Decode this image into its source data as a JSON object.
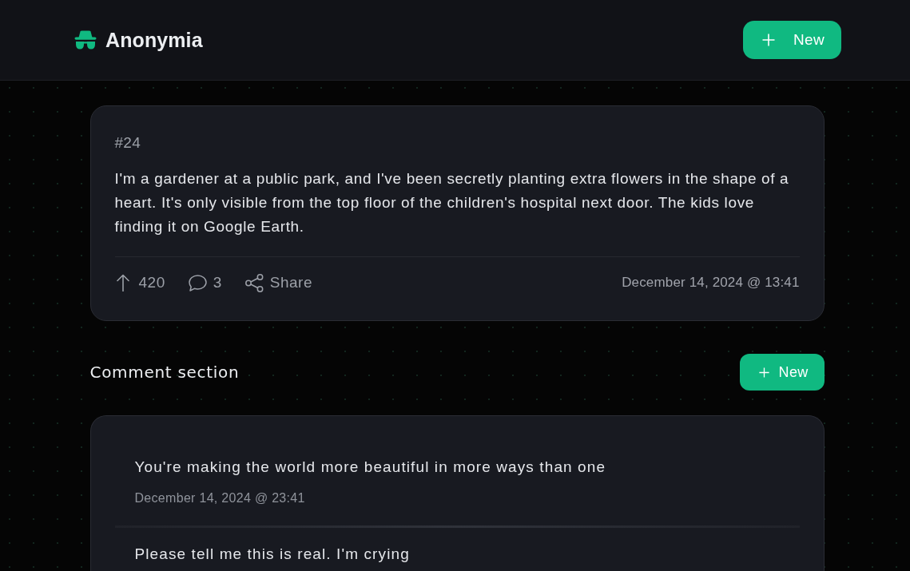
{
  "header": {
    "logo": "Anonymia",
    "new_button": "New"
  },
  "post": {
    "number": "#24",
    "text": "I'm a gardener at a public park, and I've been secretly planting extra flowers in the shape of a heart. It's only visible from the top floor of the children's hospital next door. The kids love finding it on Google Earth.",
    "upvotes": "420",
    "comments": "3",
    "share": "Share",
    "date": "December 14, 2024 @ 13:41"
  },
  "comment_section": {
    "title": "Comment section",
    "new_button": "New",
    "comments": [
      {
        "text": "You're making the world more beautiful in more ways than one",
        "date": "December 14, 2024 @ 23:41"
      },
      {
        "text": "Please tell me this is real. I'm crying"
      }
    ]
  }
}
